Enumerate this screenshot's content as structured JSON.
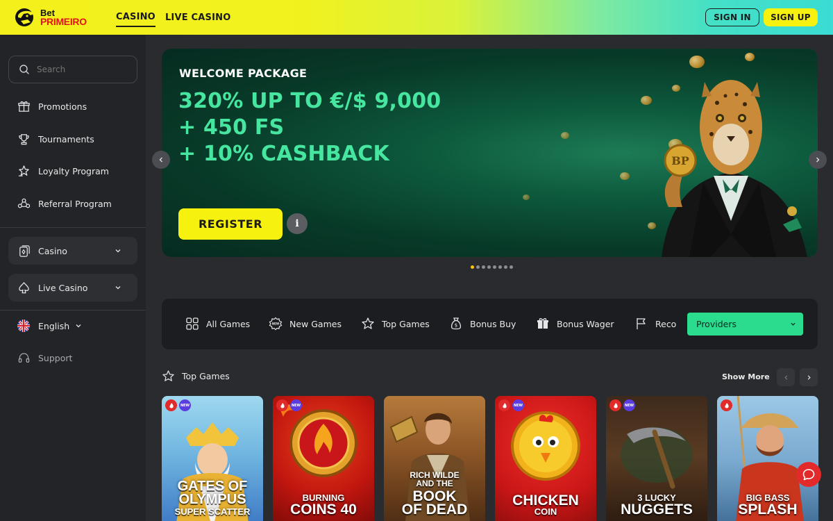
{
  "header": {
    "logo": {
      "line1": "Bet",
      "line2": "PRIMEIRO"
    },
    "nav": [
      {
        "label": "CASINO",
        "active": true
      },
      {
        "label": "LIVE CASINO",
        "active": false
      }
    ],
    "sign_in": "SIGN IN",
    "sign_up": "SIGN UP"
  },
  "sidebar": {
    "search_placeholder": "Search",
    "items": [
      {
        "label": "Promotions",
        "icon": "gift-icon"
      },
      {
        "label": "Tournaments",
        "icon": "trophy-icon"
      },
      {
        "label": "Loyalty Program",
        "icon": "loyalty-icon"
      },
      {
        "label": "Referral Program",
        "icon": "referral-icon"
      }
    ],
    "groups": [
      {
        "label": "Casino",
        "icon": "casino-icon"
      },
      {
        "label": "Live Casino",
        "icon": "spade-icon"
      }
    ],
    "language": "English",
    "support": "Support"
  },
  "banner": {
    "subtitle": "WELCOME PACKAGE",
    "lines": [
      "320% UP TO €/$ 9,000",
      "+ 450 FS",
      "+ 10% CASHBACK"
    ],
    "register": "REGISTER",
    "info": "i",
    "coin_label": "BP",
    "slides": 8,
    "active_slide": 0
  },
  "filters": {
    "items": [
      {
        "label": "All Games",
        "icon": "grid-icon"
      },
      {
        "label": "New Games",
        "icon": "new-icon"
      },
      {
        "label": "Top Games",
        "icon": "star-icon"
      },
      {
        "label": "Bonus Buy",
        "icon": "money-bag-icon"
      },
      {
        "label": "Bonus Wager",
        "icon": "gift-box-icon"
      },
      {
        "label": "Reco",
        "icon": "flag-icon"
      }
    ],
    "providers": "Providers"
  },
  "top_games": {
    "title": "Top Games",
    "show_more": "Show More",
    "new_badge": "NEW",
    "games": [
      {
        "line1": "GATES OF",
        "line2": "OLYMPUS",
        "line3": "SUPER SCATTER",
        "new": true
      },
      {
        "line1": "BURNING",
        "line2": "COINS 40",
        "line3": "",
        "new": true
      },
      {
        "line1": "RICH WILDE",
        "line2": "AND THE",
        "line3": "BOOK",
        "line4": "OF DEAD",
        "new": false
      },
      {
        "line1": "CHICKEN",
        "line2": "COIN",
        "line3": "",
        "new": true
      },
      {
        "line1": "3 LUCKY",
        "line2": "NUGGETS",
        "line3": "",
        "new": true
      },
      {
        "line1": "BIG BASS",
        "line2": "SPLASH",
        "line3": "",
        "new": false
      }
    ]
  },
  "colors": {
    "accent_yellow": "#f6f10f",
    "accent_green": "#2bdc8f",
    "banner_text": "#46e6a1",
    "hot_badge": "#e12a2a",
    "new_badge": "#5b3ce0"
  }
}
